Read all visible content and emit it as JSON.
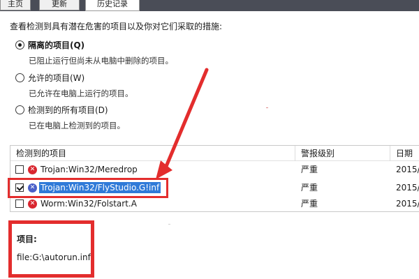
{
  "tabs": [
    {
      "label": "主页",
      "active": false
    },
    {
      "label": "更新",
      "active": false
    },
    {
      "label": "历史记录",
      "active": true
    }
  ],
  "description": "查看检测到具有潜在危害的项目以及你对它们采取的措施:",
  "options": [
    {
      "label": "隔离的项目(Q)",
      "sub": "已阻止运行但尚未从电脑中删除的项目。",
      "selected": true
    },
    {
      "label": "允许的项目(W)",
      "sub": "已允许在电脑上运行的项目。",
      "selected": false
    },
    {
      "label": "检测到的所有项目(D)",
      "sub": "已在电脑上检测到的项目。",
      "selected": false
    }
  ],
  "list": {
    "columns": [
      "检测到的项目",
      "警报级别",
      "日期"
    ],
    "rows": [
      {
        "name": "Trojan:Win32/Meredrop",
        "severity": "严重",
        "date": "2015/",
        "checked": false,
        "selected": false
      },
      {
        "name": "Trojan:Win32/FlyStudio.G!inf",
        "severity": "严重",
        "date": "2015/",
        "checked": true,
        "selected": true
      },
      {
        "name": "Worm:Win32/Folstart.A",
        "severity": "严重",
        "date": "2015/",
        "checked": false,
        "selected": false
      }
    ]
  },
  "details": {
    "title": "项目:",
    "value": "file:G:\\autorun.inf"
  },
  "colors": {
    "annotation_red": "#e32d2d",
    "selection_blue": "#2f7ad8",
    "threat_red": "#d9262f",
    "tabstrip_bg": "#4a4d57"
  },
  "icons": {
    "threat": "threat-x-icon",
    "radio": "radio-button",
    "checkbox": "checkbox"
  }
}
